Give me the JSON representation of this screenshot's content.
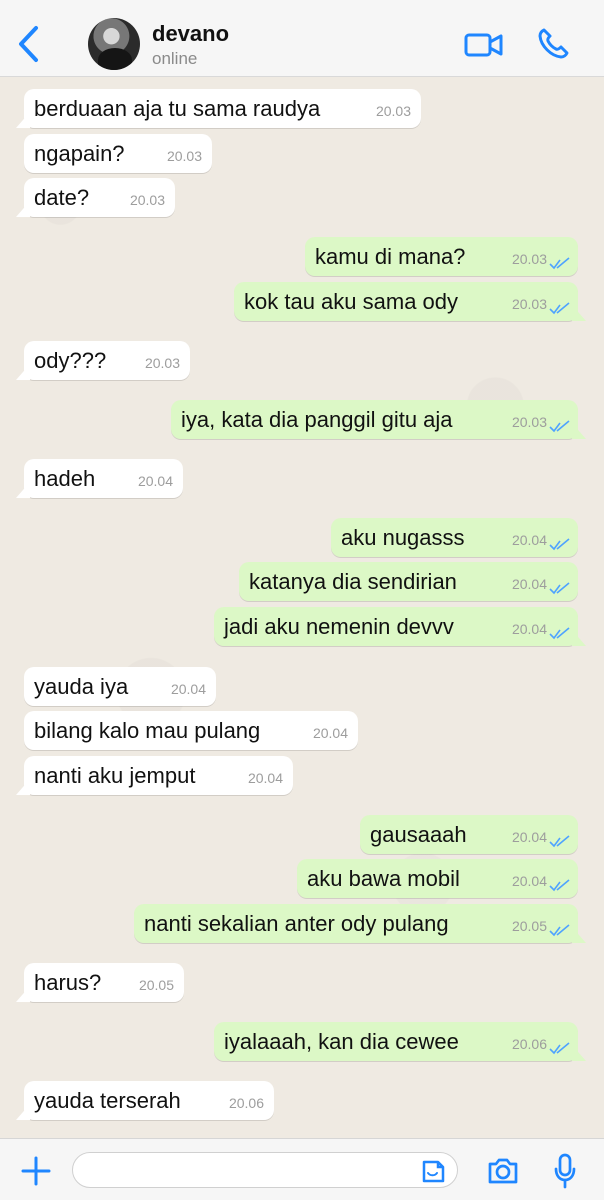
{
  "header": {
    "contact_name": "devano",
    "status": "online",
    "icons": [
      "back-icon",
      "avatar",
      "video-call-icon",
      "phone-icon"
    ]
  },
  "messages": [
    {
      "side": "in",
      "text": "berduaan aja tu sama raudya",
      "time": "20.03"
    },
    {
      "side": "in",
      "text": "ngapain?",
      "time": "20.03"
    },
    {
      "side": "in",
      "text": "date?",
      "time": "20.03"
    },
    {
      "side": "out",
      "text": "kamu di mana?",
      "time": "20.03",
      "read": true
    },
    {
      "side": "out",
      "text": "kok tau aku sama ody",
      "time": "20.03",
      "read": true
    },
    {
      "side": "in",
      "text": "ody???",
      "time": "20.03"
    },
    {
      "side": "out",
      "text": "iya, kata dia panggil gitu aja",
      "time": "20.03",
      "read": true
    },
    {
      "side": "in",
      "text": "hadeh",
      "time": "20.04"
    },
    {
      "side": "out",
      "text": "aku nugasss",
      "time": "20.04",
      "read": true
    },
    {
      "side": "out",
      "text": "katanya dia sendirian",
      "time": "20.04",
      "read": true
    },
    {
      "side": "out",
      "text": "jadi aku nemenin devvv",
      "time": "20.04",
      "read": true
    },
    {
      "side": "in",
      "text": "yauda iya",
      "time": "20.04"
    },
    {
      "side": "in",
      "text": "bilang kalo mau pulang",
      "time": "20.04"
    },
    {
      "side": "in",
      "text": "nanti aku jemput",
      "time": "20.04"
    },
    {
      "side": "out",
      "text": "gausaaah",
      "time": "20.04",
      "read": true
    },
    {
      "side": "out",
      "text": "aku bawa mobil",
      "time": "20.04",
      "read": true
    },
    {
      "side": "out",
      "text": "nanti sekalian anter ody pulang",
      "time": "20.05",
      "read": true
    },
    {
      "side": "in",
      "text": "harus?",
      "time": "20.05"
    },
    {
      "side": "out",
      "text": "iyalaaah, kan dia cewee",
      "time": "20.06",
      "read": true
    },
    {
      "side": "in",
      "text": "yauda terserah",
      "time": "20.06"
    }
  ],
  "composer": {
    "message_value": "",
    "icons": [
      "plus-icon",
      "sticker-icon",
      "camera-icon",
      "microphone-icon"
    ]
  },
  "colors": {
    "accent": "#1f86ff",
    "incoming_bubble": "#ffffff",
    "outgoing_bubble": "#dcf8c6",
    "chat_background": "#efeae2",
    "read_ticks": "#4fa3ff"
  }
}
